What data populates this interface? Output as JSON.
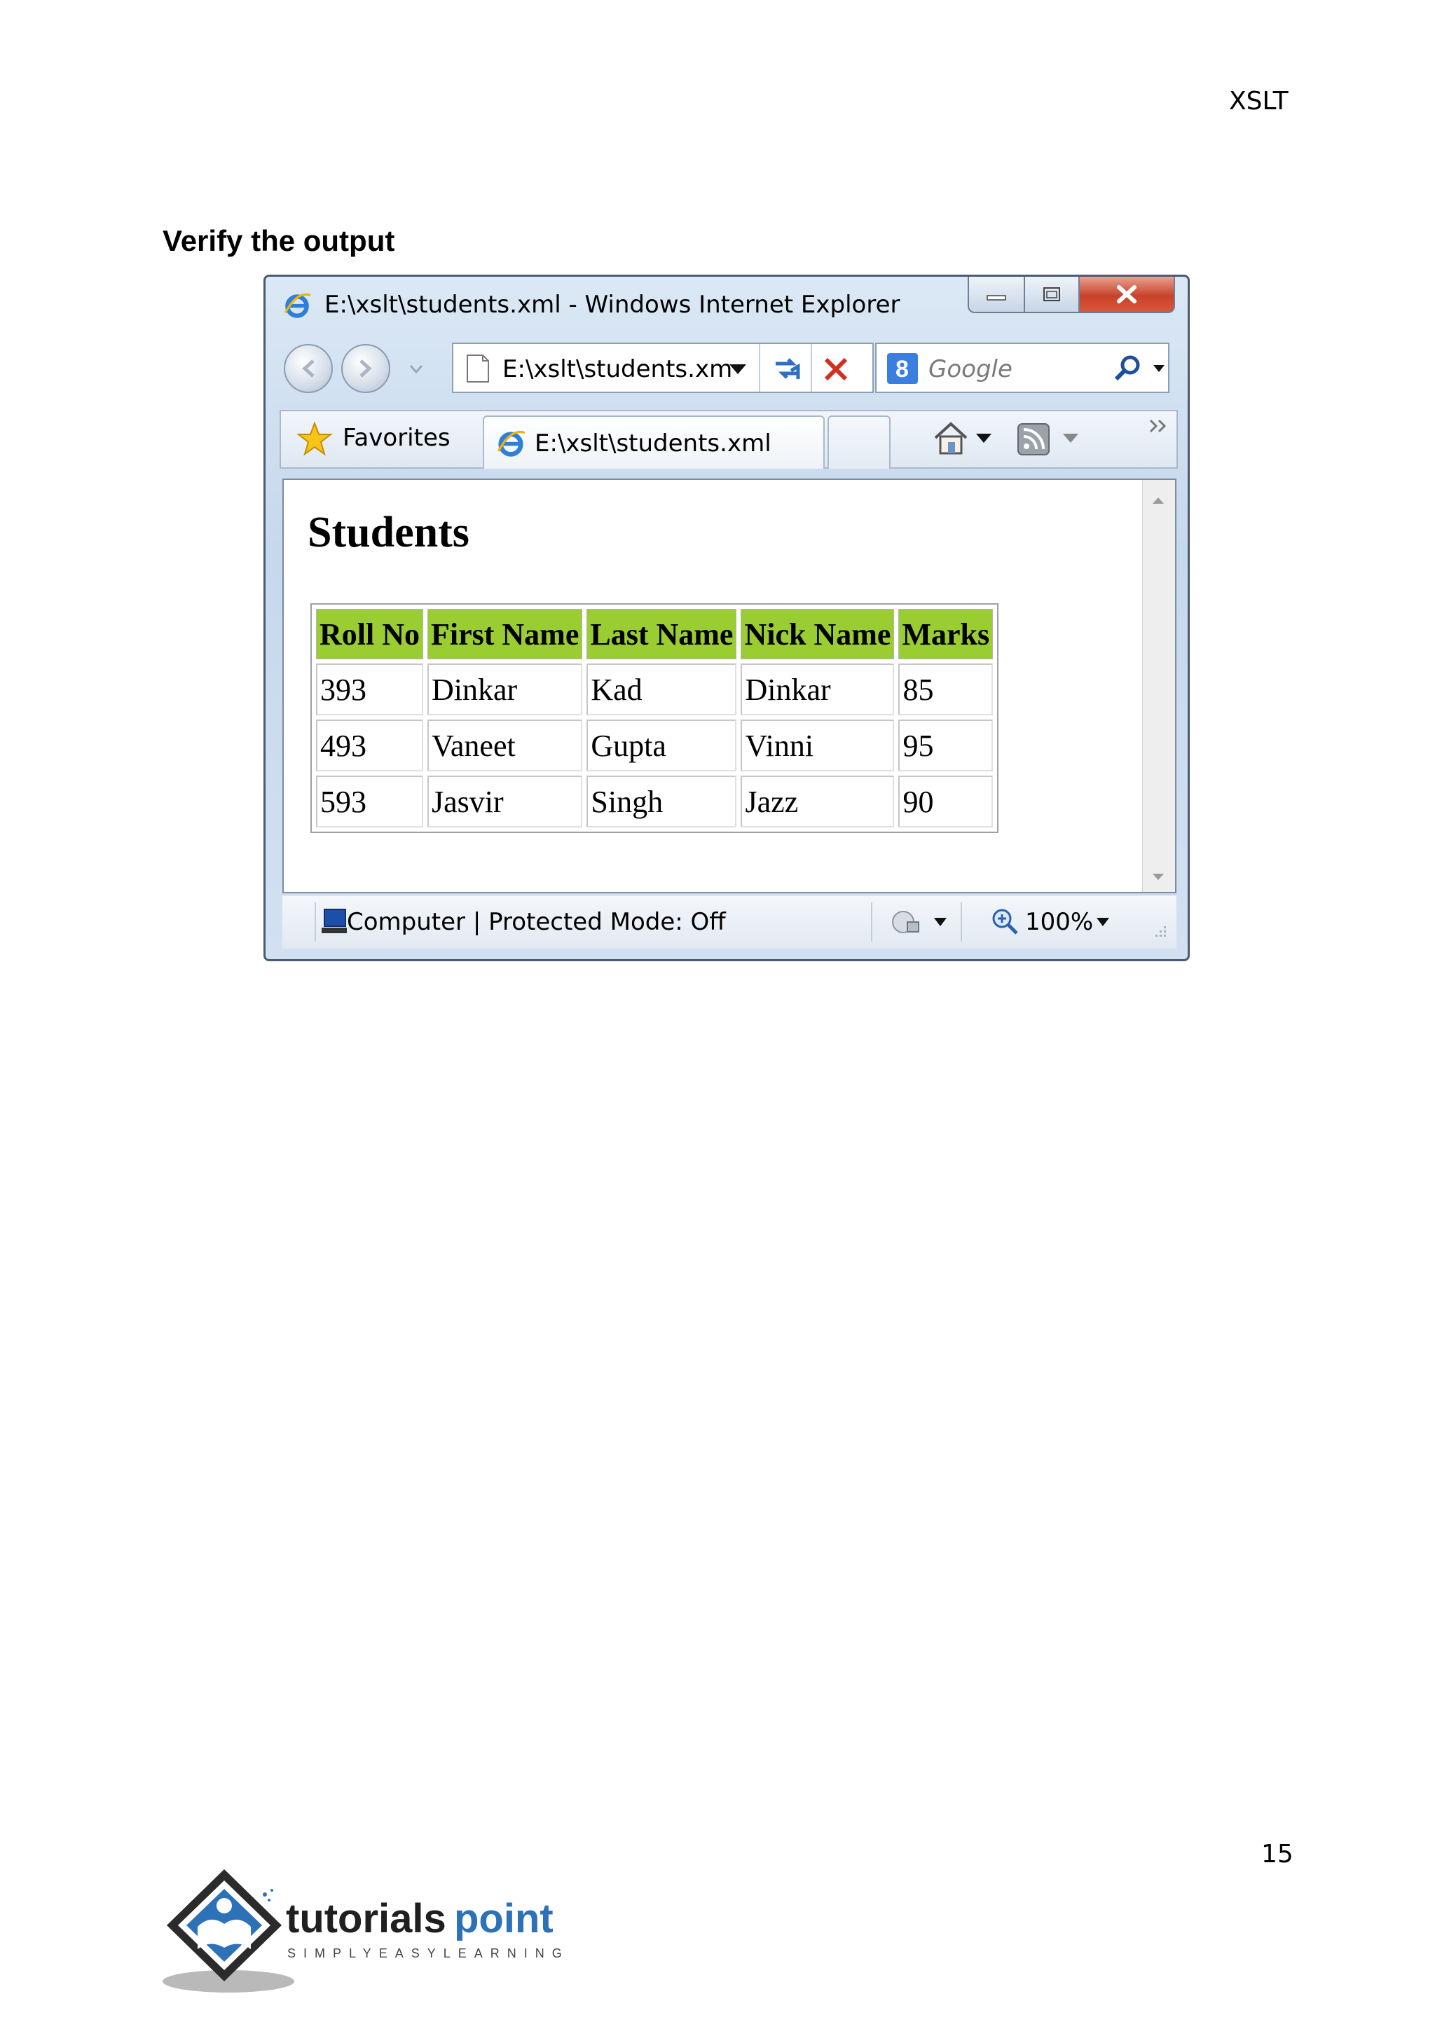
{
  "page": {
    "header": "XSLT",
    "section_title": "Verify the output",
    "page_number": "15"
  },
  "browser": {
    "window_title": "E:\\xslt\\students.xml - Windows Internet Explorer",
    "address": "E:\\xslt\\students.xm",
    "search_placeholder": "Google",
    "favorites_label": "Favorites",
    "tab_label": "E:\\xslt\\students.xml",
    "status_text": "Computer | Protected Mode: Off",
    "zoom": "100%"
  },
  "document": {
    "heading": "Students",
    "columns": [
      "Roll No",
      "First Name",
      "Last Name",
      "Nick Name",
      "Marks"
    ],
    "rows": [
      [
        "393",
        "Dinkar",
        "Kad",
        "Dinkar",
        "85"
      ],
      [
        "493",
        "Vaneet",
        "Gupta",
        "Vinni",
        "95"
      ],
      [
        "593",
        "Jasvir",
        "Singh",
        "Jazz",
        "90"
      ]
    ]
  },
  "logo": {
    "word_a": "tutorials",
    "word_b": "point",
    "tagline": "SIMPLYEASYLEARNING"
  },
  "colors": {
    "header_cell_bg": "#9acd32",
    "close_button": "#c8412a",
    "brand_blue": "#2d72b8"
  }
}
